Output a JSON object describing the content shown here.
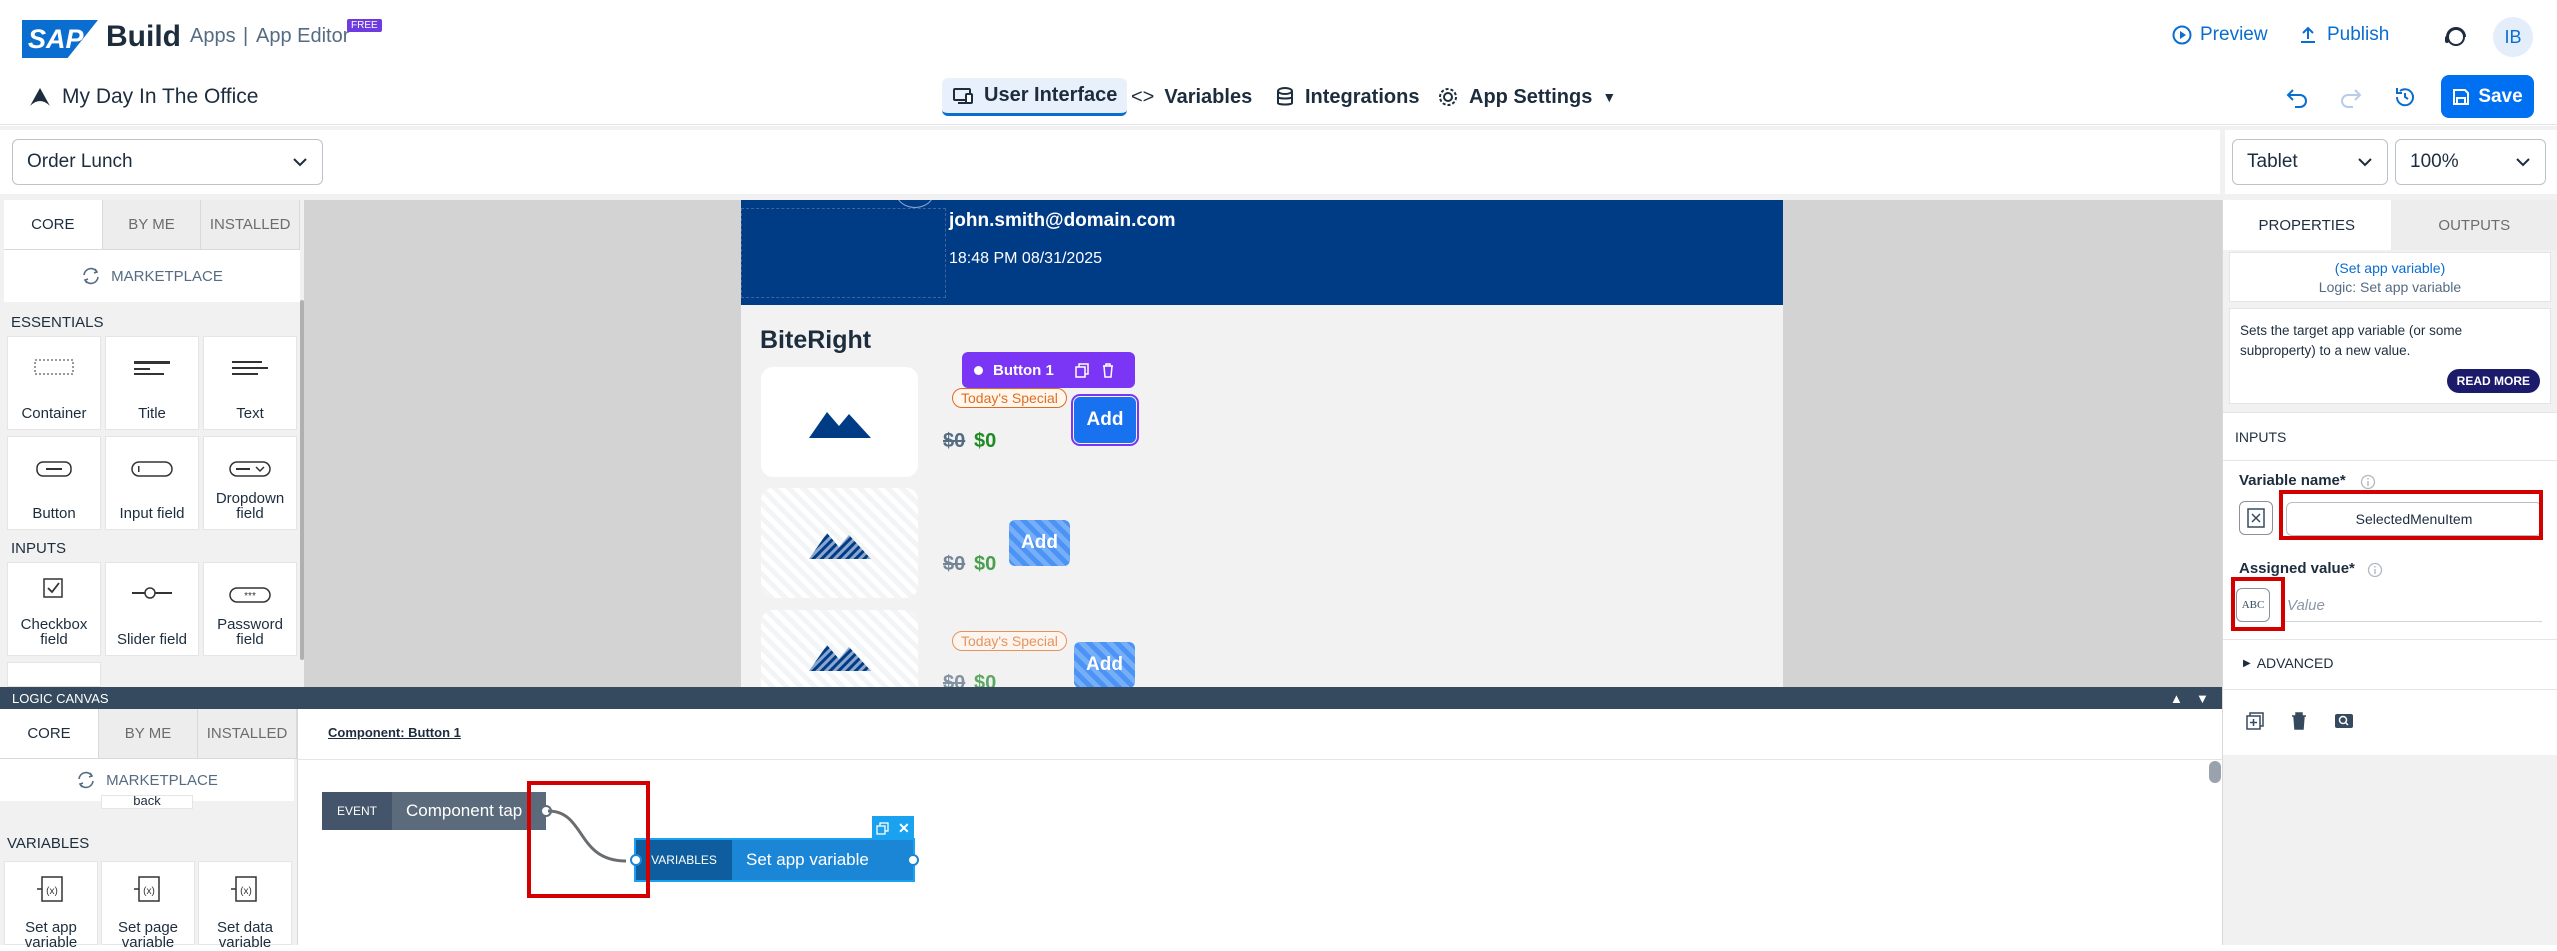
{
  "header": {
    "brand": "SAP",
    "build": "Build",
    "apps": "Apps",
    "separator": "|",
    "app_editor": "App Editor",
    "free_badge": "FREE",
    "preview": "Preview",
    "publish": "Publish",
    "avatar": "IB",
    "app_name": "My Day In The Office",
    "save": "Save"
  },
  "nav": {
    "tabs": [
      {
        "label": "User Interface"
      },
      {
        "label": "Variables"
      },
      {
        "label": "Integrations"
      },
      {
        "label": "App Settings"
      }
    ]
  },
  "toolbar": {
    "page_select": "Order Lunch",
    "device_select": "Tablet",
    "zoom_select": "100%"
  },
  "palette": {
    "tabs": [
      "CORE",
      "BY ME",
      "INSTALLED"
    ],
    "marketplace": "MARKETPLACE",
    "essentials_label": "ESSENTIALS",
    "essentials": [
      "Container",
      "Title",
      "Text",
      "Button",
      "Input field",
      "Dropdown field"
    ],
    "inputs_label": "INPUTS",
    "inputs": [
      "Checkbox field",
      "Slider field",
      "Password field"
    ]
  },
  "canvas": {
    "email": "john.smith@domain.com",
    "datetime": "18:48 PM 08/31/2025",
    "heading": "BiteRight",
    "toolbar_label": "Button 1",
    "special": "Today's Special",
    "old_price": "$0",
    "new_price": "$0",
    "add": "Add"
  },
  "logic": {
    "bar_title": "LOGIC CANVAS",
    "tabs": [
      "CORE",
      "BY ME",
      "INSTALLED"
    ],
    "marketplace": "MARKETPLACE",
    "back_fragment": "back",
    "variables_label": "VARIABLES",
    "var_tiles": [
      "Set app variable",
      "Set page variable",
      "Set data variable"
    ],
    "component_link": "Component: Button 1",
    "event_tag": "EVENT",
    "event_label": "Component tap",
    "var_tag": "VARIABLES",
    "var_label": "Set app variable"
  },
  "properties": {
    "tabs": [
      "PROPERTIES",
      "OUTPUTS"
    ],
    "title": "(Set app variable)",
    "subtitle": "Logic: Set app variable",
    "description": "Sets the target app variable (or some subproperty) to a new value.",
    "read_more": "READ MORE",
    "inputs_label": "INPUTS",
    "variable_name_label": "Variable name*",
    "variable_name_value": "SelectedMenuItem",
    "assigned_value_label": "Assigned value*",
    "assigned_value_placeholder": "Value",
    "abc_icon_text": "ABC",
    "advanced": "ADVANCED"
  },
  "colors": {
    "primary": "#0070f2",
    "header_blue": "#003b86",
    "purple": "#7b35f5",
    "dark_purple": "#1c1a6b",
    "red": "#d40000",
    "green": "#1f8b24",
    "orange": "#e06d1f"
  }
}
